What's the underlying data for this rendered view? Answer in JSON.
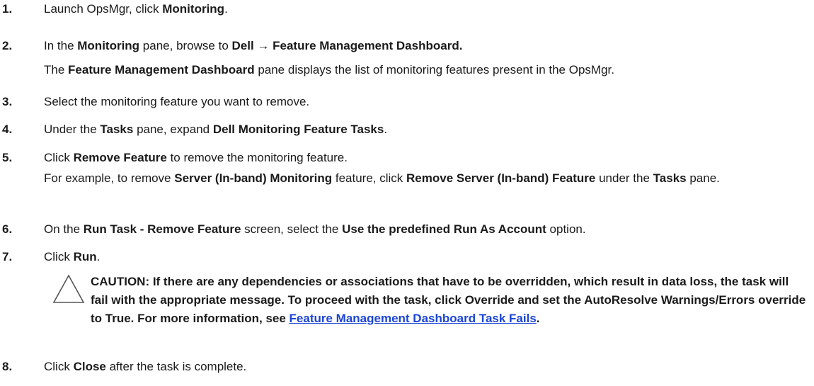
{
  "steps": [
    {
      "num": "1.",
      "parts": [
        [
          "Launch OpsMgr, click ",
          false
        ],
        [
          "Monitoring",
          true
        ],
        [
          ".",
          false
        ]
      ]
    },
    {
      "num": "2.",
      "parts": [
        [
          "In the ",
          false
        ],
        [
          "Monitoring",
          true
        ],
        [
          " pane, browse to ",
          false
        ],
        [
          "Dell",
          true
        ],
        [
          " → ",
          false
        ],
        [
          "Feature Management Dashboard.",
          true
        ]
      ]
    },
    {
      "num": "3.",
      "parts": [
        [
          "Select the monitoring feature you want to remove.",
          false
        ]
      ]
    },
    {
      "num": "4.",
      "parts": [
        [
          "Under the ",
          false
        ],
        [
          "Tasks",
          true
        ],
        [
          " pane, expand ",
          false
        ],
        [
          "Dell Monitoring Feature Tasks",
          true
        ],
        [
          ".",
          false
        ]
      ]
    },
    {
      "num": "5.",
      "parts": [
        [
          "Click ",
          false
        ],
        [
          "Remove Feature",
          true
        ],
        [
          " to remove the monitoring feature.",
          false
        ]
      ]
    },
    {
      "num": "6.",
      "parts": [
        [
          "On the ",
          false
        ],
        [
          "Run Task - Remove Feature",
          true
        ],
        [
          " screen, select the ",
          false
        ],
        [
          "Use the predefined Run As Account",
          true
        ],
        [
          " option.",
          false
        ]
      ]
    },
    {
      "num": "7.",
      "parts": [
        [
          "Click ",
          false
        ],
        [
          "Run",
          true
        ],
        [
          ".",
          false
        ]
      ]
    },
    {
      "num": "8.",
      "parts": [
        [
          "Click ",
          false
        ],
        [
          "Close",
          true
        ],
        [
          " after the task is complete.",
          false
        ]
      ]
    }
  ],
  "notes": {
    "step2_note": [
      [
        "The ",
        false
      ],
      [
        "Feature Management Dashboard",
        true
      ],
      [
        " pane displays the list of monitoring features present in the OpsMgr.",
        false
      ]
    ],
    "step5_note": [
      [
        "For example, to remove ",
        false
      ],
      [
        "Server (In-band) Monitoring",
        true
      ],
      [
        " feature, click ",
        false
      ],
      [
        "Remove Server (In-band) Feature",
        true
      ],
      [
        " under the ",
        false
      ],
      [
        "Tasks",
        true
      ],
      [
        " pane.",
        false
      ]
    ]
  },
  "caution": {
    "icon": "warning-triangle-icon",
    "text": "CAUTION: If there are any dependencies or associations that have to be overridden, which result in data loss, the task will fail with the appropriate message. To proceed with the task, click Override and set the AutoResolve Warnings/Errors override to True. For more information, see ",
    "link_text": "Feature Management Dashboard Task Fails",
    "trailing": "."
  },
  "colors": {
    "text": "#1a1a1a",
    "link": "#1a44d6",
    "icon_stroke": "#555555"
  }
}
